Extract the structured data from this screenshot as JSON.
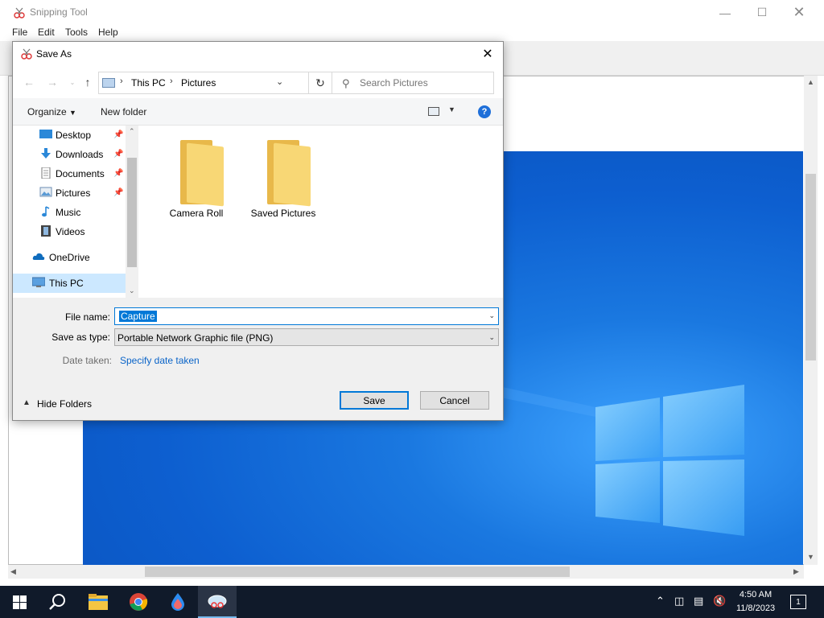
{
  "snip_window": {
    "title": "Snipping Tool",
    "menu": [
      "File",
      "Edit",
      "Tools",
      "Help"
    ]
  },
  "dialog": {
    "title": "Save As",
    "breadcrumb": [
      "This PC",
      "Pictures"
    ],
    "search_placeholder": "Search Pictures",
    "organize_label": "Organize",
    "new_folder_label": "New folder",
    "nav_items": [
      {
        "label": "Desktop",
        "icon": "desktop-icon",
        "pinned": true
      },
      {
        "label": "Downloads",
        "icon": "download-arrow-icon",
        "pinned": true
      },
      {
        "label": "Documents",
        "icon": "document-icon",
        "pinned": true
      },
      {
        "label": "Pictures",
        "icon": "pictures-icon",
        "pinned": true
      },
      {
        "label": "Music",
        "icon": "music-note-icon",
        "pinned": false
      },
      {
        "label": "Videos",
        "icon": "film-icon",
        "pinned": false
      },
      {
        "label": "OneDrive",
        "icon": "cloud-icon",
        "pinned": false
      },
      {
        "label": "This PC",
        "icon": "computer-icon",
        "pinned": false,
        "selected": true
      }
    ],
    "folders": [
      "Camera Roll",
      "Saved Pictures"
    ],
    "file_name_label": "File name:",
    "file_name_value": "Capture",
    "save_type_label": "Save as type:",
    "save_type_value": "Portable Network Graphic file (PNG)",
    "date_taken_label": "Date taken:",
    "date_taken_link": "Specify date taken",
    "hide_folders_label": "Hide Folders",
    "save_label": "Save",
    "cancel_label": "Cancel"
  },
  "taskbar": {
    "time": "4:50 AM",
    "date": "11/8/2023",
    "notification_count": "1"
  },
  "colors": {
    "accent": "#0078d7",
    "taskbar_bg": "#101a2a",
    "folder": "#f8d775",
    "link": "#0a64c8"
  }
}
